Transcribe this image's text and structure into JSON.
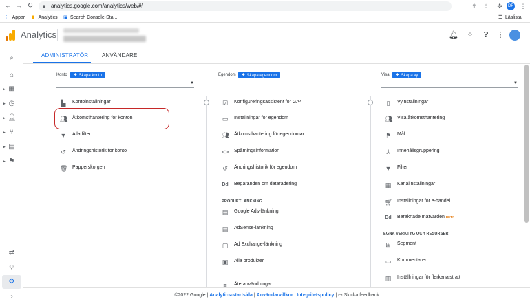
{
  "browser": {
    "url": "analytics.google.com/analytics/web/#/",
    "profile_initials": "DF",
    "reading_list": "Läslista"
  },
  "bookmarks": [
    {
      "label": "Appar"
    },
    {
      "label": "Analytics"
    },
    {
      "label": "Search Console-Sta..."
    }
  ],
  "header": {
    "app_title": "Analytics"
  },
  "tabs": {
    "admin": "ADMINISTRATÖR",
    "users": "ANVÄNDARE"
  },
  "account": {
    "label": "Konto",
    "create": "Skapa konto",
    "items": [
      {
        "label": "Kontoinställningar",
        "icon": "building-icon"
      },
      {
        "label": "Åtkomsthantering för konton",
        "icon": "people-icon"
      },
      {
        "label": "Alla filter",
        "icon": "filter-icon"
      },
      {
        "label": "Ändringshistorik för konto",
        "icon": "history-icon"
      },
      {
        "label": "Papperskorgen",
        "icon": "trash-icon"
      }
    ]
  },
  "property": {
    "label": "Egendom",
    "create": "Skapa egendom",
    "items": [
      {
        "label": "Konfigureringsassistent för GA4",
        "icon": "checkbox-icon"
      },
      {
        "label": "Inställningar för egendom",
        "icon": "window-icon"
      },
      {
        "label": "Åtkomsthantering för egendomar",
        "icon": "people-icon"
      },
      {
        "label": "Spårningsinformation",
        "icon": "code-icon"
      },
      {
        "label": "Ändringshistorik för egendom",
        "icon": "history-icon"
      },
      {
        "label": "Begäranden om dataradering",
        "icon": "dd-icon"
      }
    ],
    "links_section": "PRODUKTLÄNKNING",
    "links": [
      {
        "label": "Google Ads-länkning",
        "icon": "ads-icon"
      },
      {
        "label": "AdSense-länkning",
        "icon": "adsense-icon"
      },
      {
        "label": "Ad Exchange-länkning",
        "icon": "exchange-icon"
      },
      {
        "label": "Alla produkter",
        "icon": "products-icon"
      }
    ],
    "more": "Återanvändningar"
  },
  "view": {
    "label": "Visa",
    "create": "Skapa vy",
    "items": [
      {
        "label": "Vyinställningar",
        "icon": "doc-icon"
      },
      {
        "label": "Visa åtkomsthantering",
        "icon": "people-icon"
      },
      {
        "label": "Mål",
        "icon": "flag-icon"
      },
      {
        "label": "Innehållsgruppering",
        "icon": "walk-icon"
      },
      {
        "label": "Filter",
        "icon": "filter-icon"
      },
      {
        "label": "Kanalinställningar",
        "icon": "grid-icon"
      },
      {
        "label": "Inställningar för e-handel",
        "icon": "cart-icon"
      },
      {
        "label": "Beräknade mätvärden",
        "icon": "dd-icon",
        "badge": "BETA"
      }
    ],
    "tools_section": "EGNA VERKTYG OCH RESURSER",
    "tools": [
      {
        "label": "Segment",
        "icon": "segment-icon"
      },
      {
        "label": "Kommentarer",
        "icon": "comment-icon"
      },
      {
        "label": "Inställningar för flerkanalstratt",
        "icon": "bars-icon"
      }
    ]
  },
  "footer": {
    "copyright": "©2022 Google",
    "link1": "Analytics-startsida",
    "link2": "Användarvillkor",
    "link3": "Integritetspolicy",
    "feedback": "Skicka feedback"
  }
}
